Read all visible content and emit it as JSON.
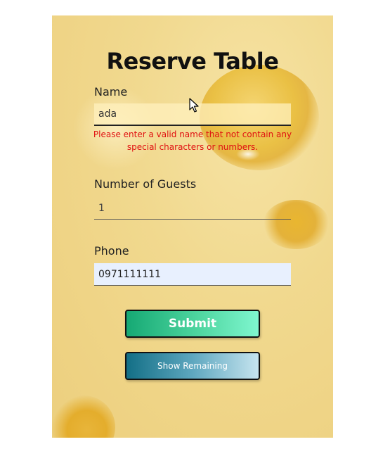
{
  "form": {
    "title": "Reserve Table",
    "name": {
      "label": "Name",
      "value": "ada",
      "error": "Please enter a valid name that not contain any special characters or numbers."
    },
    "guests": {
      "label": "Number of Guests",
      "value": "1"
    },
    "phone": {
      "label": "Phone",
      "value": "0971111111"
    },
    "submit_label": "Submit",
    "remaining_label": "Show Remaining"
  },
  "colors": {
    "error": "#e01010",
    "submit_start": "#16a974",
    "submit_end": "#7ff6cf",
    "remaining_start": "#136f86",
    "remaining_end": "#c6e4ef",
    "background": "#efd486"
  },
  "icons": {
    "pointer": "mouse-pointer-icon"
  }
}
